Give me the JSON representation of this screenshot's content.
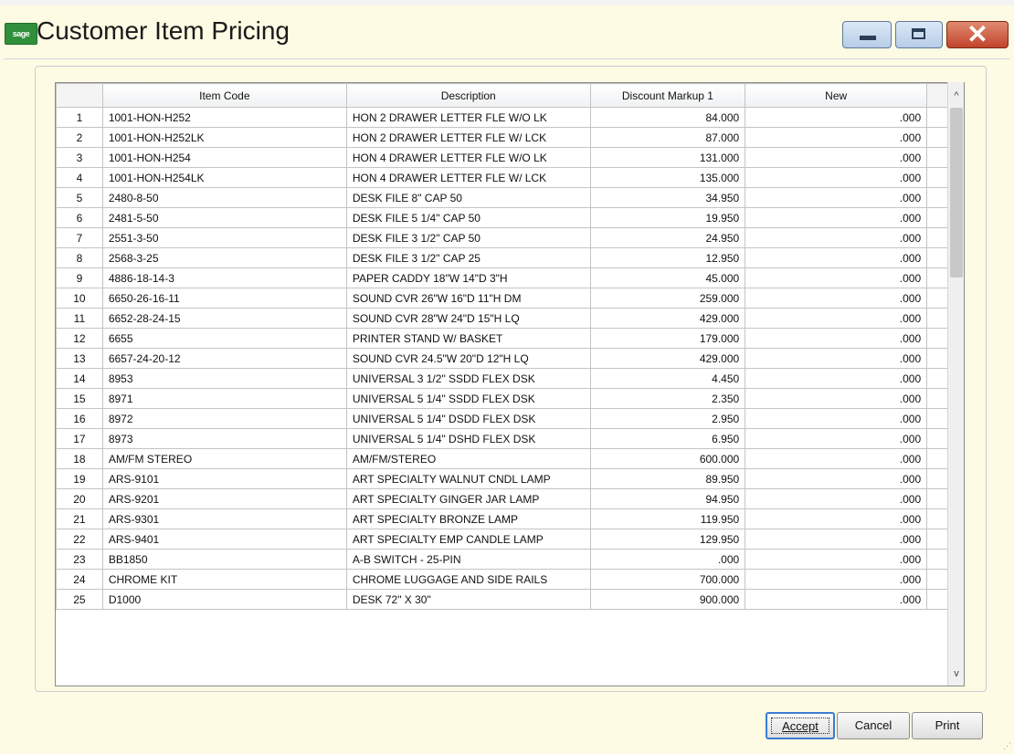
{
  "window": {
    "title": "Customer Item Pricing",
    "logo_text": "sage",
    "controls": [
      "minimize",
      "maximize",
      "close"
    ],
    "close_glyph": "✕"
  },
  "grid": {
    "columns": [
      "",
      "Item Code",
      "Description",
      "Discount Markup 1",
      "New"
    ],
    "rows": [
      [
        "1",
        "1001-HON-H252",
        "HON 2 DRAWER LETTER FLE W/O LK",
        "84.000",
        ".000"
      ],
      [
        "2",
        "1001-HON-H252LK",
        "HON 2 DRAWER LETTER FLE W/ LCK",
        "87.000",
        ".000"
      ],
      [
        "3",
        "1001-HON-H254",
        "HON 4 DRAWER LETTER FLE W/O LK",
        "131.000",
        ".000"
      ],
      [
        "4",
        "1001-HON-H254LK",
        "HON 4 DRAWER LETTER FLE W/ LCK",
        "135.000",
        ".000"
      ],
      [
        "5",
        "2480-8-50",
        "DESK FILE 8\" CAP 50",
        "34.950",
        ".000"
      ],
      [
        "6",
        "2481-5-50",
        "DESK FILE 5 1/4\" CAP 50",
        "19.950",
        ".000"
      ],
      [
        "7",
        "2551-3-50",
        "DESK FILE 3 1/2\" CAP 50",
        "24.950",
        ".000"
      ],
      [
        "8",
        "2568-3-25",
        "DESK FILE 3 1/2\" CAP 25",
        "12.950",
        ".000"
      ],
      [
        "9",
        "4886-18-14-3",
        "PAPER CADDY 18\"W 14\"D 3\"H",
        "45.000",
        ".000"
      ],
      [
        "10",
        "6650-26-16-11",
        "SOUND CVR 26\"W 16\"D 11\"H DM",
        "259.000",
        ".000"
      ],
      [
        "11",
        "6652-28-24-15",
        "SOUND CVR 28\"W 24\"D 15\"H LQ",
        "429.000",
        ".000"
      ],
      [
        "12",
        "6655",
        "PRINTER STAND W/ BASKET",
        "179.000",
        ".000"
      ],
      [
        "13",
        "6657-24-20-12",
        "SOUND CVR 24.5\"W 20\"D 12\"H LQ",
        "429.000",
        ".000"
      ],
      [
        "14",
        "8953",
        "UNIVERSAL 3 1/2\" SSDD FLEX DSK",
        "4.450",
        ".000"
      ],
      [
        "15",
        "8971",
        "UNIVERSAL 5 1/4\" SSDD FLEX DSK",
        "2.350",
        ".000"
      ],
      [
        "16",
        "8972",
        "UNIVERSAL 5 1/4\" DSDD FLEX DSK",
        "2.950",
        ".000"
      ],
      [
        "17",
        "8973",
        "UNIVERSAL 5 1/4\" DSHD FLEX DSK",
        "6.950",
        ".000"
      ],
      [
        "18",
        "AM/FM STEREO",
        "AM/FM/STEREO",
        "600.000",
        ".000"
      ],
      [
        "19",
        "ARS-9101",
        "ART SPECIALTY WALNUT CNDL LAMP",
        "89.950",
        ".000"
      ],
      [
        "20",
        "ARS-9201",
        "ART SPECIALTY GINGER JAR LAMP",
        "94.950",
        ".000"
      ],
      [
        "21",
        "ARS-9301",
        "ART SPECIALTY BRONZE LAMP",
        "119.950",
        ".000"
      ],
      [
        "22",
        "ARS-9401",
        "ART SPECIALTY EMP CANDLE LAMP",
        "129.950",
        ".000"
      ],
      [
        "23",
        "BB1850",
        "A-B SWITCH - 25-PIN",
        ".000",
        ".000"
      ],
      [
        "24",
        "CHROME KIT",
        "CHROME LUGGAGE AND SIDE RAILS",
        "700.000",
        ".000"
      ],
      [
        "25",
        "D1000",
        "DESK 72\" X 30\"",
        "900.000",
        ".000"
      ]
    ]
  },
  "scrollbar": {
    "up_icon": "chevron-up-icon",
    "down_icon": "chevron-down-icon",
    "up_glyph": "^",
    "down_glyph": "v"
  },
  "buttons": {
    "accept": "Accept",
    "cancel": "Cancel",
    "print": "Print"
  },
  "colors": {
    "window_bg": "#fdfbe4",
    "grid_bg": "#ffffff",
    "close_button": "#c1432a",
    "accept_border": "#3b7dcf"
  }
}
